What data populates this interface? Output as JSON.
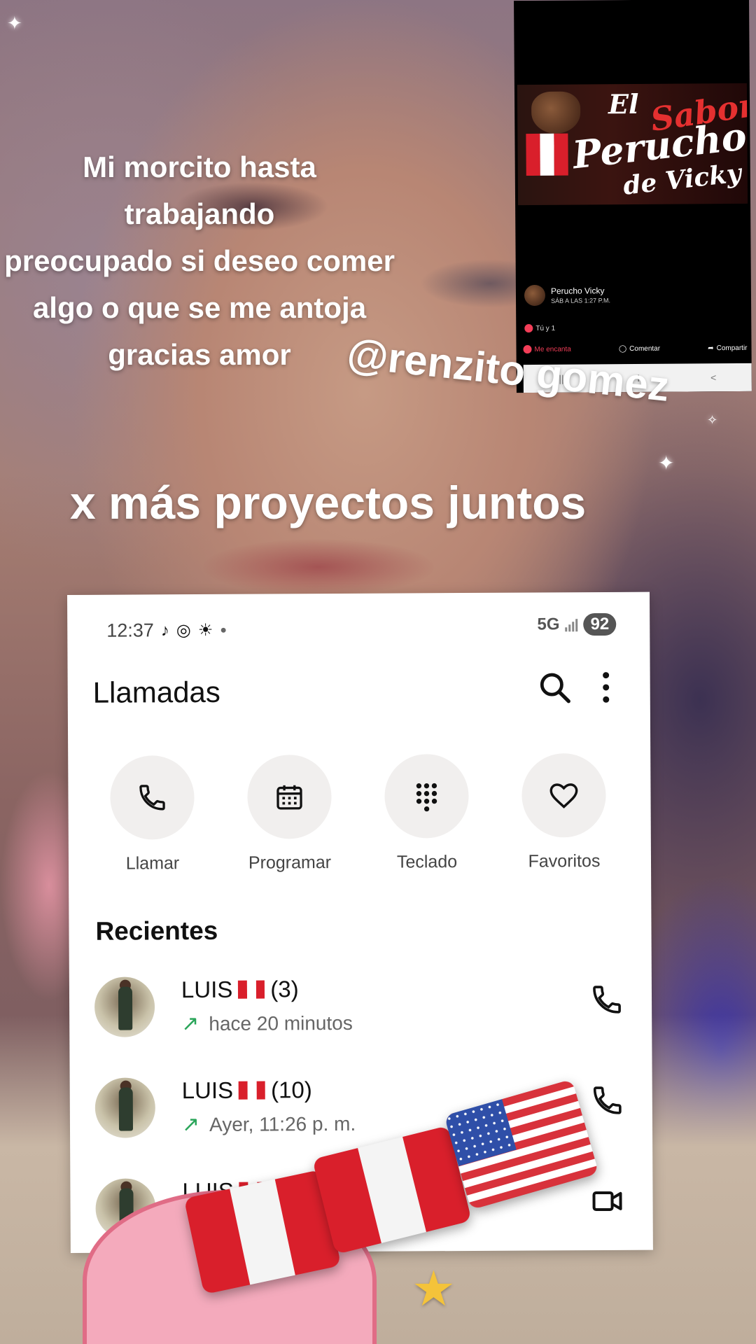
{
  "caption": {
    "lines": [
      "Mi morcito hasta",
      "trabajando",
      "preocupado si deseo comer",
      "algo o que se me antoja",
      "gracias amor"
    ]
  },
  "handle": "@renzito gomez",
  "tagline": "x más  proyectos juntos",
  "fb_post": {
    "banner_words": [
      "El",
      "Sabor",
      "Perucho",
      "de Vicky"
    ],
    "author": "Perucho Vicky",
    "time": "SÁB A LAS 1:27 P.M.",
    "reactions": "Tú y 1",
    "actions": {
      "like": "Me encanta",
      "comment": "Comentar",
      "share": "Compartir"
    },
    "nav": [
      "|||",
      "I",
      "<"
    ]
  },
  "status_bar": {
    "time": "12:37",
    "network": "5G",
    "battery": "92"
  },
  "app": {
    "title": "Llamadas",
    "quick_actions": [
      {
        "label": "Llamar",
        "icon": "phone-icon"
      },
      {
        "label": "Programar",
        "icon": "calendar-icon"
      },
      {
        "label": "Teclado",
        "icon": "dialpad-icon"
      },
      {
        "label": "Favoritos",
        "icon": "heart-icon"
      }
    ],
    "section_title": "Recientes",
    "recents": [
      {
        "name": "LUIS",
        "count": "(3)",
        "when": "hace 20 minutos",
        "action_icon": "phone-icon"
      },
      {
        "name": "LUIS",
        "count": "(10)",
        "when": "Ayer, 11:26 p. m.",
        "action_icon": "phone-icon"
      },
      {
        "name": "LUIS",
        "count": "",
        "when": "",
        "action_icon": "video-icon"
      }
    ]
  },
  "colors": {
    "peru_red": "#d91f2b",
    "outgoing_arrow": "#2aa55a",
    "fb_love": "#f33e58"
  }
}
